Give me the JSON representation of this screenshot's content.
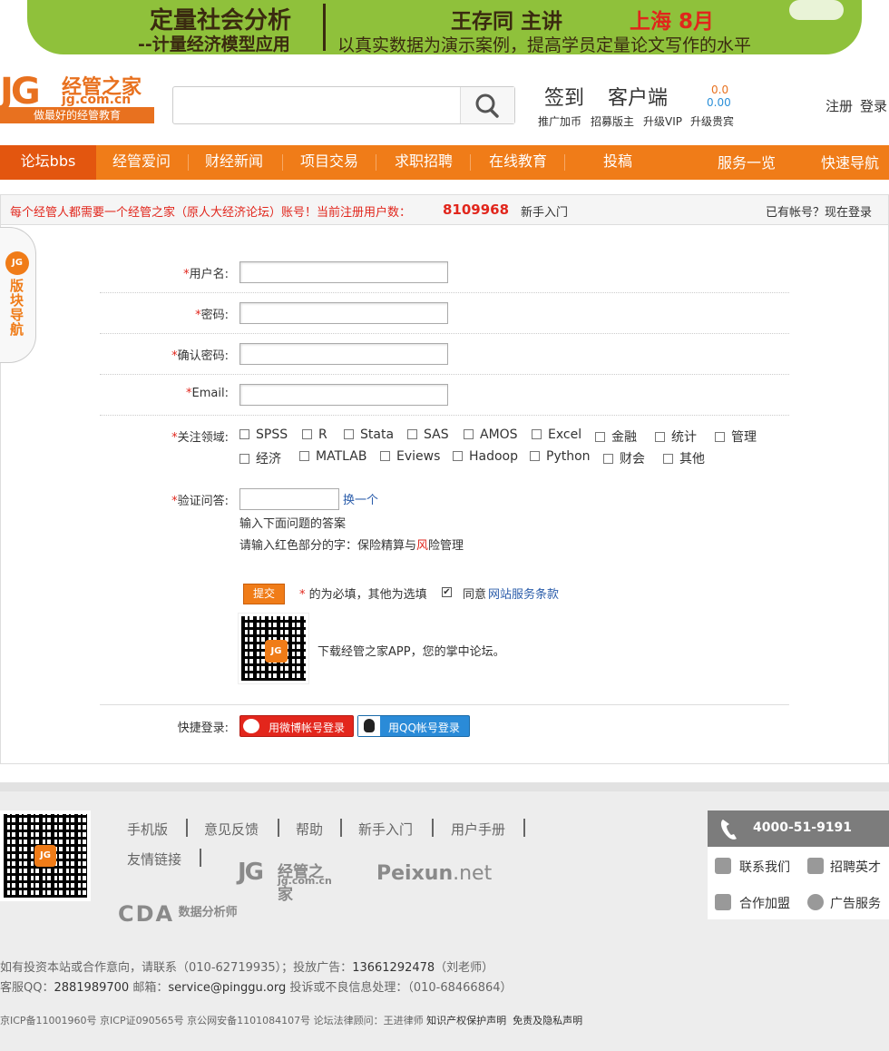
{
  "banner": {
    "title": "定量社会分析",
    "subtitle": "--计量经济模型应用",
    "lecturer": "王存同  主讲",
    "city_month": "上海 8月",
    "tagline": "以真实数据为演示案例，提高学员定量论文写作的水平"
  },
  "logo": {
    "jg": "JG",
    "cn": "经管之家",
    "url": "jg.com.cn",
    "slogan": "做最好的经管教育"
  },
  "search": {
    "placeholder": ""
  },
  "header": {
    "signin": "签到",
    "client": "客户端",
    "coin_top": "0.0",
    "coin_bottom": "0.00",
    "links": [
      "推广加币",
      "招募版主",
      "升级VIP",
      "升级贵宾"
    ],
    "register": "注册",
    "login": "登录"
  },
  "nav": {
    "items": [
      "论坛bbs",
      "经管爱问",
      "财经新闻",
      "项目交易",
      "求职招聘",
      "在线教育",
      "投稿"
    ],
    "service": "服务一览",
    "quicknav": "快速导航"
  },
  "notice": {
    "text": "每个经管人都需要一个经管之家（原人大经济论坛）账号！当前注册用户数：",
    "count": "8109968",
    "newbie": "新手入门",
    "has_account": "已有帐号？现在登录"
  },
  "side_tab": {
    "label": "版块导航"
  },
  "form": {
    "username_label": "用户名:",
    "password_label": "密码:",
    "confirm_label": "确认密码:",
    "email_label": "Email:",
    "fields_label": "关注领域:",
    "fields_row1": [
      "SPSS",
      "R",
      "Stata",
      "SAS",
      "AMOS",
      "Excel",
      "金融",
      "统计",
      "管理"
    ],
    "fields_row2": [
      "经济",
      "MATLAB",
      "Eviews",
      "Hadoop",
      "Python",
      "财会",
      "其他"
    ],
    "verify_label": "验证问答:",
    "change_one": "换一个",
    "verify_hint": "输入下面问题的答案",
    "verify_q_pre": "请输入红色部分的字：保险精算与",
    "verify_q_red": "风",
    "verify_q_post": "险管理",
    "required_mark": "*",
    "submit": "提交",
    "required_note": " 的为必填，其他为选填",
    "agree": "同意",
    "terms": "网站服务条款",
    "app_text": "下载经管之家APP，您的掌中论坛。",
    "quick_login_label": "快捷登录:",
    "weibo_login": "用微博帐号登录",
    "qq_login": "用QQ帐号登录"
  },
  "footer": {
    "links": [
      "手机版",
      "意见反馈",
      "帮助",
      "新手入门",
      "用户手册"
    ],
    "friend_links": "友情链接",
    "partner_jg": "经管之家",
    "partner_jg_url": "jg.com.cn",
    "partner_peixun": "Peixun",
    "partner_peixun_net": ".net",
    "partner_cda": "CDA",
    "partner_cda_cn": "数据分析师",
    "phone": "4000-51-9191",
    "contact": [
      "联系我们",
      "招聘英才",
      "合作加盟",
      "广告服务"
    ],
    "line1_pre": "如有投资本站或合作意向，请联系（010-62719935）；投放广告：",
    "line1_phone": "13661292478",
    "line1_post": "（刘老师）",
    "line2_pre": "客服QQ：",
    "line2_qq": "2881989700",
    "line2_mail_pre": " 邮箱：",
    "line2_mail": "service@pinggu.org",
    "line2_post": " 投诉或不良信息处理：（010-68466864）",
    "line3": "京ICP备11001960号 京ICP证090565号 京公网安备1101084107号 论坛法律顾问：王进律师",
    "line3_ip": "知识产权保护声明",
    "line3_privacy": "免责及隐私声明"
  },
  "colors": {
    "orange": "#f07c18",
    "red": "#e1261c",
    "link": "#2a5caa"
  }
}
